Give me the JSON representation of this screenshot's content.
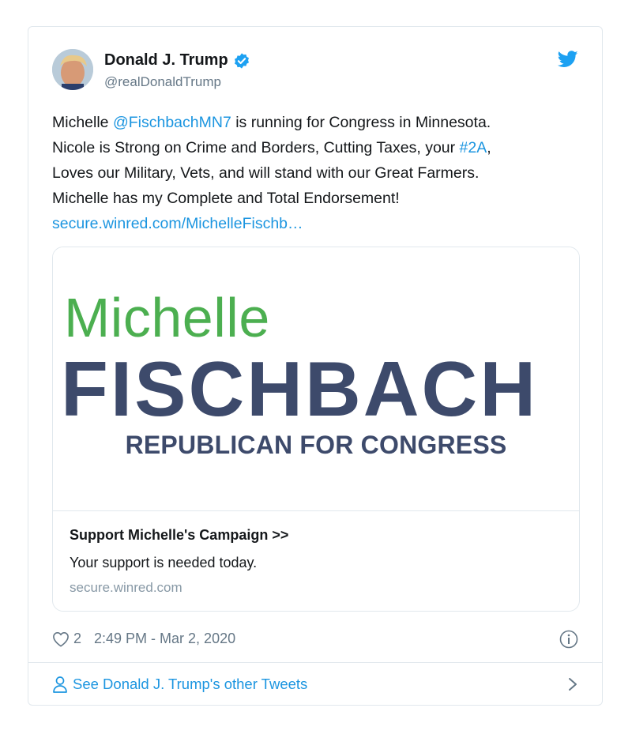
{
  "tweet": {
    "author_name": "Donald J. Trump",
    "author_handle": "@realDonaldTrump",
    "text_segments": {
      "l1a": "Michelle ",
      "l1_mention": "@FischbachMN7",
      "l1b": " is running for Congress in Minnesota.",
      "l2a": "Nicole is Strong on Crime and Borders, Cutting Taxes, your ",
      "l2_hashtag": "#2A",
      "l2b": ",",
      "l3": "Loves our Military, Vets, and will stand with our Great Farmers.",
      "l4": "Michelle has my Complete and Total Endorsement!",
      "l5_link": "secure.winred.com/MichelleFischb…"
    },
    "likes": "2",
    "timestamp": "2:49 PM - Mar 2, 2020"
  },
  "card": {
    "banner_first": "Michelle",
    "banner_last": "FISCHBACH",
    "banner_sub": "REPUBLICAN FOR CONGRESS",
    "title": "Support Michelle's Campaign >>",
    "description": "Your support is needed today.",
    "domain": "secure.winred.com"
  },
  "footer": {
    "label": "See Donald J. Trump's other Tweets"
  },
  "colors": {
    "link": "#1b95e0",
    "banner_green": "#4caf50",
    "banner_navy": "#3d4a6b",
    "muted": "#657786"
  },
  "icons": [
    "verified-badge-icon",
    "twitter-bird-icon",
    "heart-icon",
    "info-icon",
    "person-icon",
    "chevron-right-icon"
  ]
}
